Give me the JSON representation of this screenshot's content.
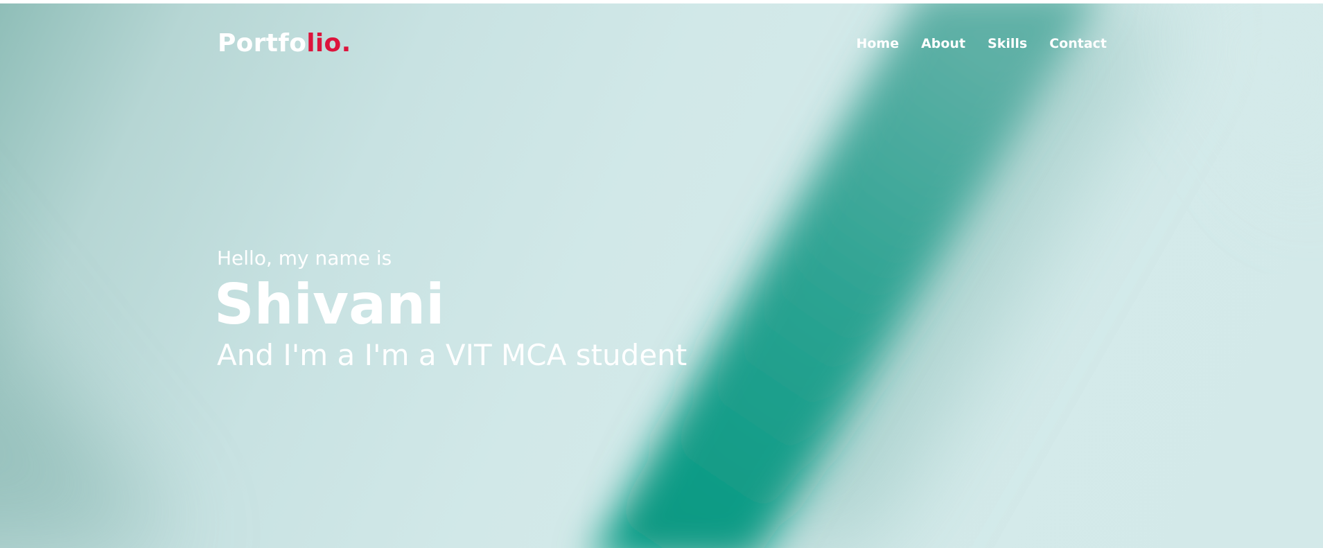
{
  "brand": {
    "logo_main": "Portfo",
    "logo_accent": "lio.",
    "accent_color": "#dc143c"
  },
  "nav": {
    "items": [
      {
        "label": "Home"
      },
      {
        "label": "About"
      },
      {
        "label": "Skills"
      },
      {
        "label": "Contact"
      }
    ]
  },
  "hero": {
    "greeting": "Hello, my name is",
    "name": "Shivani",
    "tagline": "And I'm a I'm a VIT MCA student",
    "background_color": "#d2e8e8",
    "band_color": "#00977f"
  }
}
